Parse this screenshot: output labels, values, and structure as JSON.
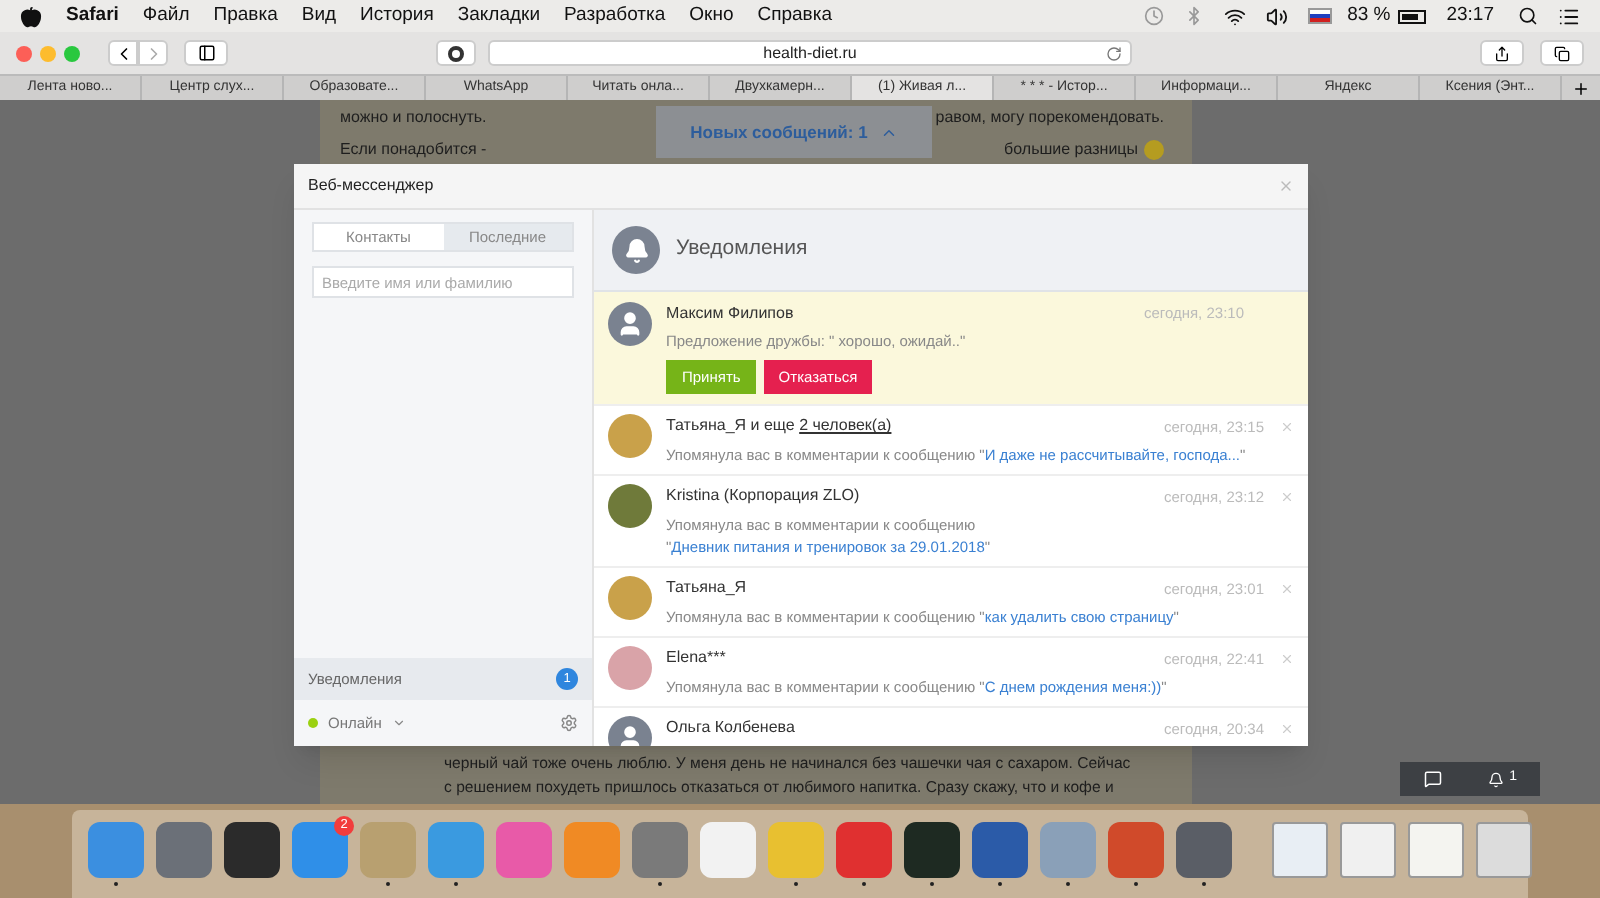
{
  "menubar": {
    "app": "Safari",
    "menus": [
      "Файл",
      "Правка",
      "Вид",
      "История",
      "Закладки",
      "Разработка",
      "Окно",
      "Справка"
    ],
    "battery": "83 %",
    "time": "23:17"
  },
  "toolbar": {
    "address": "health-diet.ru"
  },
  "tabs": [
    {
      "label": "Лента ново...",
      "selected": false
    },
    {
      "label": "Центр слух...",
      "selected": false
    },
    {
      "label": "Образовате...",
      "selected": false
    },
    {
      "label": "WhatsApp",
      "selected": false
    },
    {
      "label": "Читать онла...",
      "selected": false
    },
    {
      "label": "Двухкамерн...",
      "selected": false
    },
    {
      "label": "(1) Живая л...",
      "selected": true
    },
    {
      "label": "* * * - Истор...",
      "selected": false
    },
    {
      "label": "Информаци...",
      "selected": false
    },
    {
      "label": "Яндекс",
      "selected": false
    },
    {
      "label": "Ксения (Энт...",
      "selected": false
    }
  ],
  "page": {
    "text_top": [
      {
        "left": "можно и полоснуть.",
        "right": "равом, могу порекомендовать."
      },
      {
        "left": "Если понадобится -",
        "right": "большие разницы"
      }
    ],
    "new_messages": "Новых сообщений: 1",
    "text_bottom": [
      "черный чай тоже очень люблю. У меня день не начинался без чашечки чая с сахаром. Сейчас",
      "с решением похудеть пришлось отказаться от любимого напитка. Сразу скажу, что и кофе и"
    ],
    "widget_count": "1"
  },
  "messenger": {
    "title": "Веб-мессенджер",
    "tabs": [
      {
        "label": "Контакты",
        "selected": true
      },
      {
        "label": "Последние",
        "selected": false
      }
    ],
    "search": {
      "placeholder": "Введите имя или фамилию"
    },
    "notifications_label": "Уведомления",
    "notifications_count": "1",
    "status": {
      "label": "Онлайн",
      "online": true
    },
    "panel_title": "Уведомления",
    "request": {
      "kind": "default",
      "color": "#7a8290",
      "name": "Максим Филипов",
      "text": "Предложение дружбы: \" хорошо, ожидай..\"",
      "time": "сегодня, 23:10",
      "accept": "Принять",
      "decline": "Отказаться"
    },
    "items": [
      {
        "kind": "photo",
        "color": "#c9a14a",
        "author": "Татьяна_Я и еще ",
        "author_link": "2 человек(а)",
        "action": "Упомянула вас в комментарии к сообщению \"",
        "link": "И даже не рассчитывайте, господа...",
        "after": "\"",
        "time": "сегодня, 23:15"
      },
      {
        "kind": "photo",
        "color": "#6f7a3a",
        "author": "Kristina (Корпорация ZLO)",
        "action": "Упомянула вас в комментарии к сообщению \"",
        "link": "Дневник питания и тренировок за 29.01.2018",
        "after": "\"",
        "time": "сегодня, 23:12"
      },
      {
        "kind": "photo",
        "color": "#c9a14a",
        "author": "Татьяна_Я",
        "action": "Упомянула вас в комментарии к сообщению \"",
        "link": "как удалить свою страницу",
        "after": "\"",
        "time": "сегодня, 23:01"
      },
      {
        "kind": "photo",
        "color": "#d9a3a8",
        "author": "Elena***",
        "action": "Упомянула вас в комментарии к сообщению \"",
        "link": "С днем рождения меня:))",
        "after": "\"",
        "time": "сегодня, 22:41"
      },
      {
        "kind": "default",
        "color": "#7a8290",
        "author": "Ольга Колбенева",
        "time": "сегодня, 20:34"
      }
    ]
  },
  "dock": [
    {
      "color": "#3b8fe0",
      "running": true
    },
    {
      "color": "#6b7078",
      "running": false
    },
    {
      "color": "#2b2b2b",
      "running": false
    },
    {
      "color": "#2f8fe8",
      "running": false,
      "badge": "2"
    },
    {
      "color": "#b8a070",
      "running": true
    },
    {
      "color": "#3a9ae0",
      "running": true
    },
    {
      "color": "#e85aa8",
      "running": false
    },
    {
      "color": "#f08a24",
      "running": false
    },
    {
      "color": "#7a7a7a",
      "running": true
    },
    {
      "color": "#f2f2f2",
      "running": false
    },
    {
      "color": "#e8c030",
      "running": true
    },
    {
      "color": "#e03030",
      "running": true
    },
    {
      "color": "#1e2a22",
      "running": true
    },
    {
      "color": "#2b5ba8",
      "running": true
    },
    {
      "color": "#8aa0b8",
      "running": true
    },
    {
      "color": "#d04a2a",
      "running": true
    },
    {
      "color": "#5a5e66",
      "running": true
    }
  ],
  "dock_docs": [
    {
      "color": "#e8eef4"
    },
    {
      "color": "#f0f0f0"
    },
    {
      "color": "#f4f4f0"
    },
    {
      "color": "#dcdcdc"
    }
  ]
}
